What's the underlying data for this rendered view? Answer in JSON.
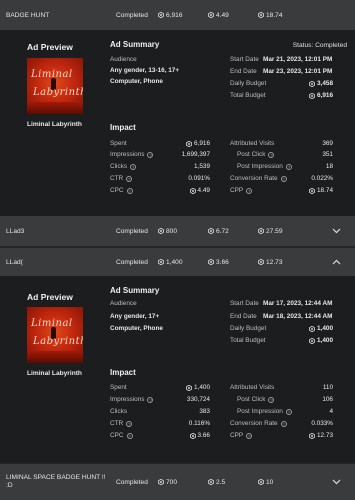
{
  "rows": [
    {
      "name": "BADGE HUNT",
      "status": "Completed",
      "spent": "6,916",
      "cpc": "4.49",
      "cpp": "18.74",
      "expanded": false
    },
    {
      "name": "LLad3",
      "status": "Completed",
      "spent": "800",
      "cpc": "6.72",
      "cpp": "27.59",
      "expanded": false
    },
    {
      "name": "LLad(",
      "status": "Completed",
      "spent": "1,400",
      "cpc": "3.66",
      "cpp": "12.73",
      "expanded": true
    },
    {
      "name": "LIMINAL SPACE BADGE HUNT !! :D",
      "status": "Completed",
      "spent": "700",
      "cpc": "2.5",
      "cpp": "10",
      "expanded": false
    }
  ],
  "panels": [
    {
      "preview_title": "Ad Preview",
      "thumb_text_1": "Liminal",
      "thumb_text_2": "Labyrinth",
      "game_name": "Liminal Labyrinth",
      "summary_title": "Ad Summary",
      "status_label": "Status:",
      "status_value": "Completed",
      "audience_label": "Audience",
      "audience_1": "Any gender, 13-16, 17+",
      "audience_2": "Computer, Phone",
      "start_label": "Start Date",
      "start_value": "Mar 21, 2023, 12:01 PM",
      "end_label": "End Date",
      "end_value": "Mar 23, 2023, 12:01 PM",
      "daily_label": "Daily Budget",
      "daily_value": "3,458",
      "total_label": "Total Budget",
      "total_value": "6,916",
      "impact_title": "Impact",
      "left": [
        {
          "label": "Spent",
          "value": "6,916",
          "robux": true
        },
        {
          "label": "Impressions",
          "value": "1,699,397",
          "robux": false
        },
        {
          "label": "Clicks",
          "value": "1,539",
          "robux": false
        },
        {
          "label": "CTR",
          "value": "0.091%",
          "robux": false
        },
        {
          "label": "CPC",
          "value": "4.49",
          "robux": true
        }
      ],
      "right": [
        {
          "label": "Attributed Visits",
          "value": "369",
          "robux": false
        },
        {
          "label": "Post Click",
          "value": "351",
          "robux": false
        },
        {
          "label": "Post Impression",
          "value": "18",
          "robux": false
        },
        {
          "label": "Conversion Rate",
          "value": "0.022%",
          "robux": false
        },
        {
          "label": "CPP",
          "value": "18.74",
          "robux": true
        }
      ]
    },
    {
      "preview_title": "Ad Preview",
      "thumb_text_1": "Liminal",
      "thumb_text_2": "Labyrinth",
      "game_name": "Liminal Labyrinth",
      "summary_title": "Ad Summary",
      "status_label": "",
      "status_value": "",
      "audience_label": "Audience",
      "audience_1": "Any gender, 17+",
      "audience_2": "Computer, Phone",
      "start_label": "Start Date",
      "start_value": "Mar 17, 2023, 12:44 AM",
      "end_label": "End Date",
      "end_value": "Mar 18, 2023, 12:44 AM",
      "daily_label": "Daily Budget",
      "daily_value": "1,400",
      "total_label": "Total Budget",
      "total_value": "1,400",
      "impact_title": "Impact",
      "left": [
        {
          "label": "Spent",
          "value": "1,400",
          "robux": true
        },
        {
          "label": "Impressions",
          "value": "330,724",
          "robux": false
        },
        {
          "label": "Clicks",
          "value": "383",
          "robux": false
        },
        {
          "label": "CTR",
          "value": "0.116%",
          "robux": false
        },
        {
          "label": "CPC",
          "value": "3.66",
          "robux": true
        }
      ],
      "right": [
        {
          "label": "Attributed Visits",
          "value": "110",
          "robux": false
        },
        {
          "label": "Post Click",
          "value": "106",
          "robux": false
        },
        {
          "label": "Post Impression",
          "value": "4",
          "robux": false
        },
        {
          "label": "Conversion Rate",
          "value": "0.033%",
          "robux": false
        },
        {
          "label": "CPP",
          "value": "12.73",
          "robux": true
        }
      ]
    }
  ],
  "icons": {
    "currency": "robux-icon",
    "help": "help-circle-icon",
    "expand": "chevron-down-icon",
    "collapse": "chevron-up-icon"
  }
}
